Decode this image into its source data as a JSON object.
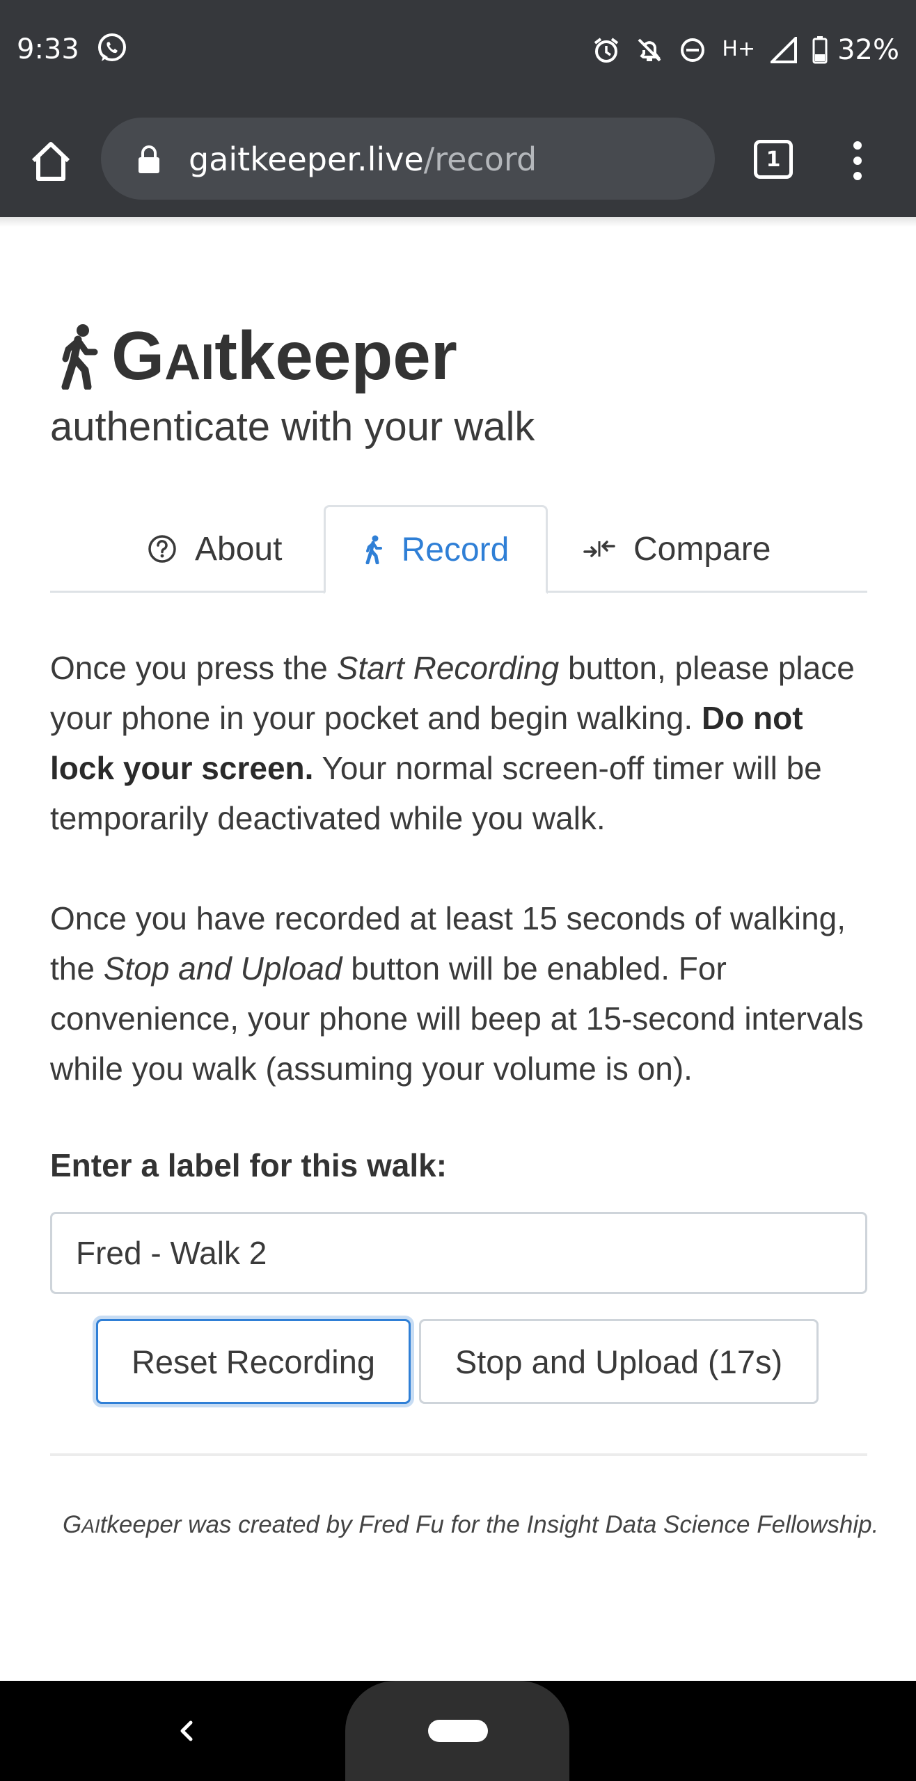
{
  "status_bar": {
    "time": "9:33",
    "network": "H+",
    "battery": "32%",
    "icons": [
      "whatsapp-icon",
      "alarm-icon",
      "notifications-off-icon",
      "do-not-disturb-icon",
      "signal-icon",
      "battery-icon"
    ]
  },
  "browser": {
    "url_host": "gaitkeeper.live",
    "url_path": "/record",
    "tab_count": "1"
  },
  "header": {
    "brand_prefix": "G",
    "brand_smallcaps": "AI",
    "brand_suffix": "tkeeper",
    "subtitle": "authenticate with your walk"
  },
  "tabs": [
    {
      "label": "About",
      "icon": "question-circle-icon",
      "active": false
    },
    {
      "label": "Record",
      "icon": "walking-icon",
      "active": true
    },
    {
      "label": "Compare",
      "icon": "compress-arrows-icon",
      "active": false
    }
  ],
  "instructions": {
    "p1_a": "Once you press the ",
    "p1_em": "Start Recording",
    "p1_b": " button, please place your phone in your pocket and begin walking. ",
    "p1_strong": "Do not lock your screen.",
    "p1_c": " Your normal screen-off timer will be temporarily deactivated while you walk.",
    "p2_a": "Once you have recorded at least 15 seconds of walking, the ",
    "p2_em": "Stop and Upload",
    "p2_b": " button will be enabled. For convenience, your phone will beep at 15-second intervals while you walk (assuming your volume is on)."
  },
  "form": {
    "label": "Enter a label for this walk:",
    "walk_label_value": "Fred - Walk 2",
    "reset_button": "Reset Recording",
    "stop_button": "Stop and Upload (17s)"
  },
  "footer": {
    "brand_prefix": "G",
    "brand_smallcaps": "AI",
    "brand_suffix": "tkeeper",
    "text": " was created by Fred Fu for the Insight Data Science Fellowship."
  },
  "colors": {
    "accent": "#2f7fd6",
    "chrome": "#36383c",
    "urlbar": "#474a4f"
  }
}
